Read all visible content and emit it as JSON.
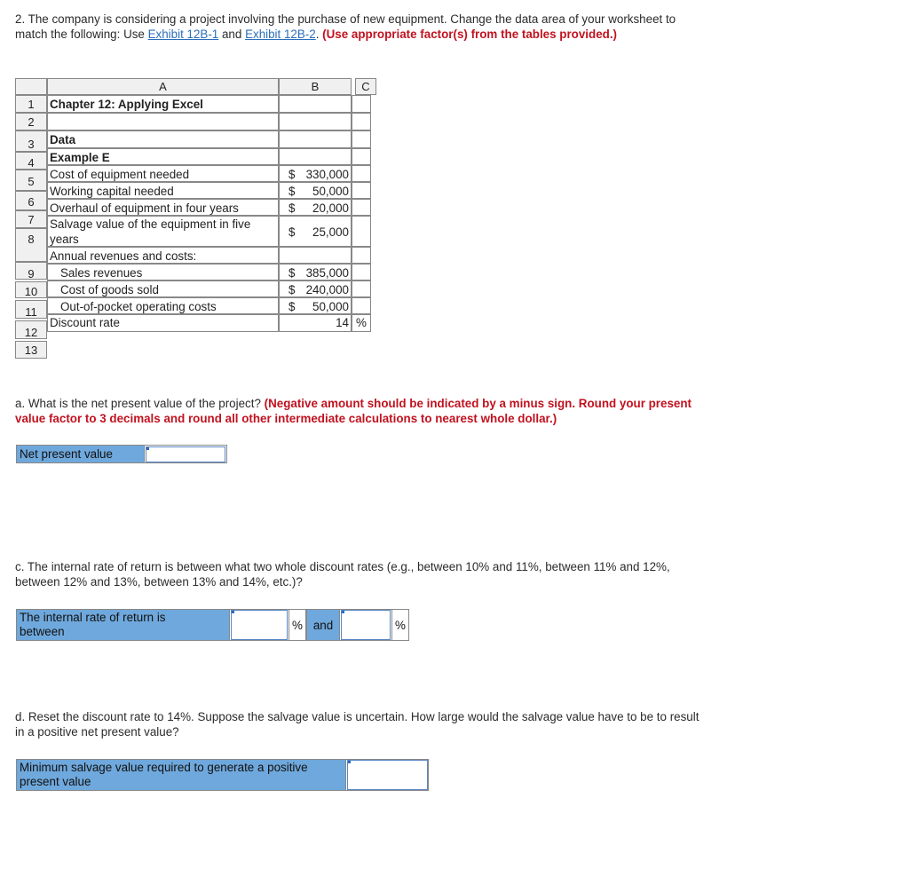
{
  "question": {
    "intro_part1": "2. The company is considering a project involving the purchase of new equipment. Change the data area of your worksheet to match the following: Use ",
    "link1": "Exhibit 12B-1",
    "and_text": " and ",
    "link2": "Exhibit 12B-2",
    "period": ". ",
    "instruction": "(Use appropriate factor(s) from the tables provided.)"
  },
  "spreadsheet": {
    "columns": [
      "A",
      "B",
      "C"
    ],
    "row_numbers": [
      "1",
      "2",
      "3",
      "4",
      "5",
      "6",
      "7",
      "8",
      "9",
      "10",
      "11",
      "12",
      "13"
    ],
    "title": "Chapter 12: Applying Excel",
    "rows": [
      {
        "label": "Data",
        "value": ""
      },
      {
        "label": "Example E",
        "value": ""
      },
      {
        "label": "Cost of equipment needed",
        "sign": "$",
        "value": "330,000"
      },
      {
        "label": "Working capital needed",
        "sign": "$",
        "value": "50,000"
      },
      {
        "label": "Overhaul of equipment in four years",
        "sign": "$",
        "value": "20,000"
      },
      {
        "label_line1": "Salvage value of the equipment in five",
        "label_line2": "years",
        "sign": "$",
        "value": "25,000"
      },
      {
        "label": "Annual revenues and costs:",
        "value": ""
      },
      {
        "label": "Sales revenues",
        "sign": "$",
        "value": "385,000"
      },
      {
        "label": "Cost of goods sold",
        "sign": "$",
        "value": "240,000"
      },
      {
        "label": "Out-of-pocket operating costs",
        "sign": "$",
        "value": "50,000"
      },
      {
        "label": "Discount rate",
        "value": "14",
        "unit": "%"
      }
    ]
  },
  "part_a": {
    "question": "a. What is the net present value of the project? ",
    "instruction": "(Negative amount should be indicated by a minus sign. Round your present value factor to 3 decimals and round all other intermediate calculations to nearest whole dollar.)",
    "label": "Net present value",
    "value": ""
  },
  "part_c": {
    "question": "c. The internal rate of return is between what two whole discount rates (e.g., between 10% and 11%, between 11% and 12%, between 12% and 13%, between 13% and 14%, etc.)?",
    "label_line1": "The internal rate of return is",
    "label_line2": "between",
    "value1": "",
    "unit1": "%",
    "and_label": "and",
    "value2": "",
    "unit2": "%"
  },
  "part_d": {
    "question": "d. Reset the discount rate to 14%. Suppose the salvage value is uncertain. How large would the salvage value have to be to result in a positive net present value?",
    "label_line1": "Minimum salvage value required to generate a positive",
    "label_line2": "present value",
    "value": ""
  }
}
